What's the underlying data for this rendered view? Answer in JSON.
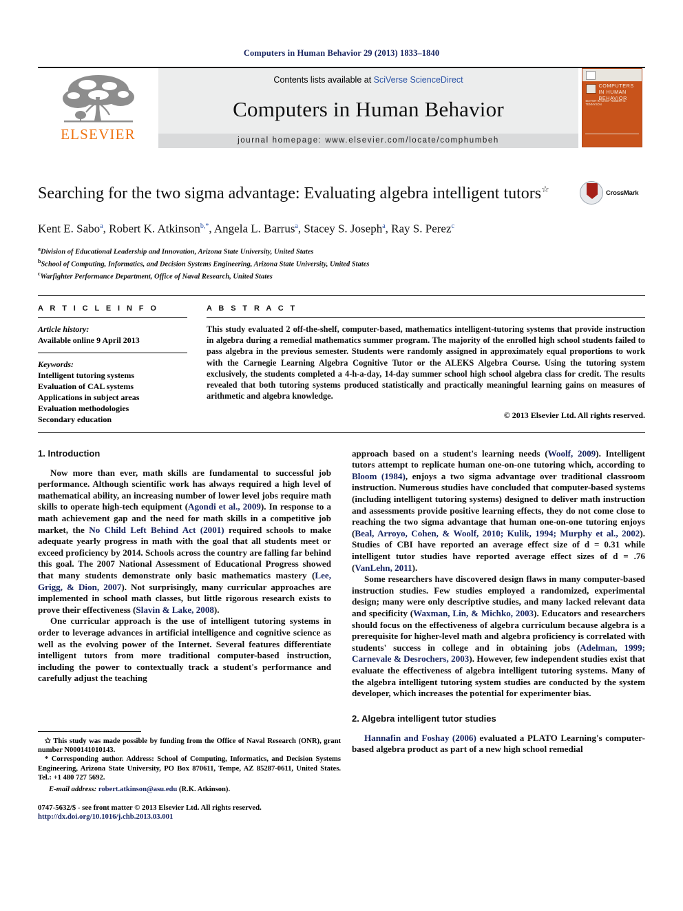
{
  "running_head": "Computers in Human Behavior 29 (2013) 1833–1840",
  "banner": {
    "contents_prefix": "Contents lists available at ",
    "sciencedirect": "SciVerse ScienceDirect",
    "journal_title": "Computers in Human Behavior",
    "homepage": "journal homepage: www.elsevier.com/locate/comphumbeh",
    "publisher": "ELSEVIER",
    "cover_title": "COMPUTERS IN HUMAN BEHAVIOR",
    "cover_subtitle": "EDITOR-IN-CHIEF\nROBERT D. TENNYSON"
  },
  "article": {
    "title": "Searching for the two sigma advantage: Evaluating algebra intelligent tutors",
    "title_marker": "☆",
    "authors": "Kent E. Sabo a, Robert K. Atkinson b,*, Angela L. Barrus a, Stacey S. Joseph a, Ray S. Perez c",
    "crossmark_label": "CrossMark",
    "affiliations": [
      {
        "marker": "a",
        "text": "Division of Educational Leadership and Innovation, Arizona State University, United States"
      },
      {
        "marker": "b",
        "text": "School of Computing, Informatics, and Decision Systems Engineering, Arizona State University, United States"
      },
      {
        "marker": "c",
        "text": "Warfighter Performance Department, Office of Naval Research, United States"
      }
    ]
  },
  "article_info": {
    "heading": "A R T I C L E    I N F O",
    "history_label": "Article history:",
    "history_value": "Available online 9 April 2013",
    "keywords_label": "Keywords:",
    "keywords": [
      "Intelligent tutoring systems",
      "Evaluation of CAL systems",
      "Applications in subject areas",
      "Evaluation methodologies",
      "Secondary education"
    ]
  },
  "abstract": {
    "heading": "A B S T R A C T",
    "text": "This study evaluated 2 off-the-shelf, computer-based, mathematics intelligent-tutoring systems that provide instruction in algebra during a remedial mathematics summer program. The majority of the enrolled high school students failed to pass algebra in the previous semester. Students were randomly assigned in approximately equal proportions to work with the Carnegie Learning Algebra Cognitive Tutor or the ALEKS Algebra Course. Using the tutoring system exclusively, the students completed a 4-h-a-day, 14-day summer school high school algebra class for credit. The results revealed that both tutoring systems produced statistically and practically meaningful learning gains on measures of arithmetic and algebra knowledge.",
    "copyright": "© 2013 Elsevier Ltd. All rights reserved."
  },
  "sections": {
    "intro_heading": "1. Introduction",
    "algebra_heading": "2. Algebra intelligent tutor studies"
  },
  "left_column": {
    "p1": "Now more than ever, math skills are fundamental to successful job performance. Although scientific work has always required a high level of mathematical ability, an increasing number of lower level jobs require math skills to operate high-tech equipment (Agondi et al., 2009). In response to a math achievement gap and the need for math skills in a competitive job market, the No Child Left Behind Act (2001) required schools to make adequate yearly progress in math with the goal that all students meet or exceed proficiency by 2014. Schools across the country are falling far behind this goal. The 2007 National Assessment of Educational Progress showed that many students demonstrate only basic mathematics mastery (Lee, Grigg, & Dion, 2007). Not surprisingly, many curricular approaches are implemented in school math classes, but little rigorous research exists to prove their effectiveness (Slavin & Lake, 2008).",
    "p2": "One curricular approach is the use of intelligent tutoring systems in order to leverage advances in artificial intelligence and cognitive science as well as the evolving power of the Internet. Several features differentiate intelligent tutors from more traditional computer-based instruction, including the power to contextually track a student's performance and carefully adjust the teaching"
  },
  "right_column": {
    "p1": "approach based on a student's learning needs (Woolf, 2009). Intelligent tutors attempt to replicate human one-on-one tutoring which, according to Bloom (1984), enjoys a two sigma advantage over traditional classroom instruction. Numerous studies have concluded that computer-based systems (including intelligent tutoring systems) designed to deliver math instruction and assessments provide positive learning effects, they do not come close to reaching the two sigma advantage that human one-on-one tutoring enjoys (Beal, Arroyo, Cohen, & Woolf, 2010; Kulik, 1994; Murphy et al., 2002). Studies of CBI have reported an average effect size of d = 0.31 while intelligent tutor studies have reported average effect sizes of d = .76 (VanLehn, 2011).",
    "p2": "Some researchers have discovered design flaws in many computer-based instruction studies. Few studies employed a randomized, experimental design; many were only descriptive studies, and many lacked relevant data and specificity (Waxman, Lin, & Michko, 2003). Educators and researchers should focus on the effectiveness of algebra curriculum because algebra is a prerequisite for higher-level math and algebra proficiency is correlated with students' success in college and in obtaining jobs (Adelman, 1999; Carnevale & Desrochers, 2003). However, few independent studies exist that evaluate the effectiveness of algebra intelligent tutoring systems. Many of the algebra intelligent tutoring system studies are conducted by the system developer, which increases the potential for experimenter bias.",
    "p3": "Hannafin and Foshay (2006) evaluated a PLATO Learning's computer-based algebra product as part of a new high school remedial"
  },
  "footnotes": {
    "funding": "This study was made possible by funding from the Office of Naval Research (ONR), grant number N000141010143.",
    "funding_marker": "✩",
    "corresponding_marker": "*",
    "corresponding": "Corresponding author. Address: School of Computing, Informatics, and Decision Systems Engineering, Arizona State University, PO Box 870611, Tempe, AZ 85287-0611, United States. Tel.: +1 480 727 5692.",
    "email_label": "E-mail address:",
    "email": "robert.atkinson@asu.edu",
    "email_owner": "(R.K. Atkinson)."
  },
  "footer": {
    "issn_line": "0747-5632/$ - see front matter © 2013 Elsevier Ltd. All rights reserved.",
    "doi": "http://dx.doi.org/10.1016/j.chb.2013.03.001"
  },
  "colors": {
    "reference_blue": "#16235f",
    "link_blue": "#2a52a5",
    "elsevier_orange": "#ee7211",
    "cover_orange": "#c8531b",
    "crossmark_red": "#a52019"
  }
}
